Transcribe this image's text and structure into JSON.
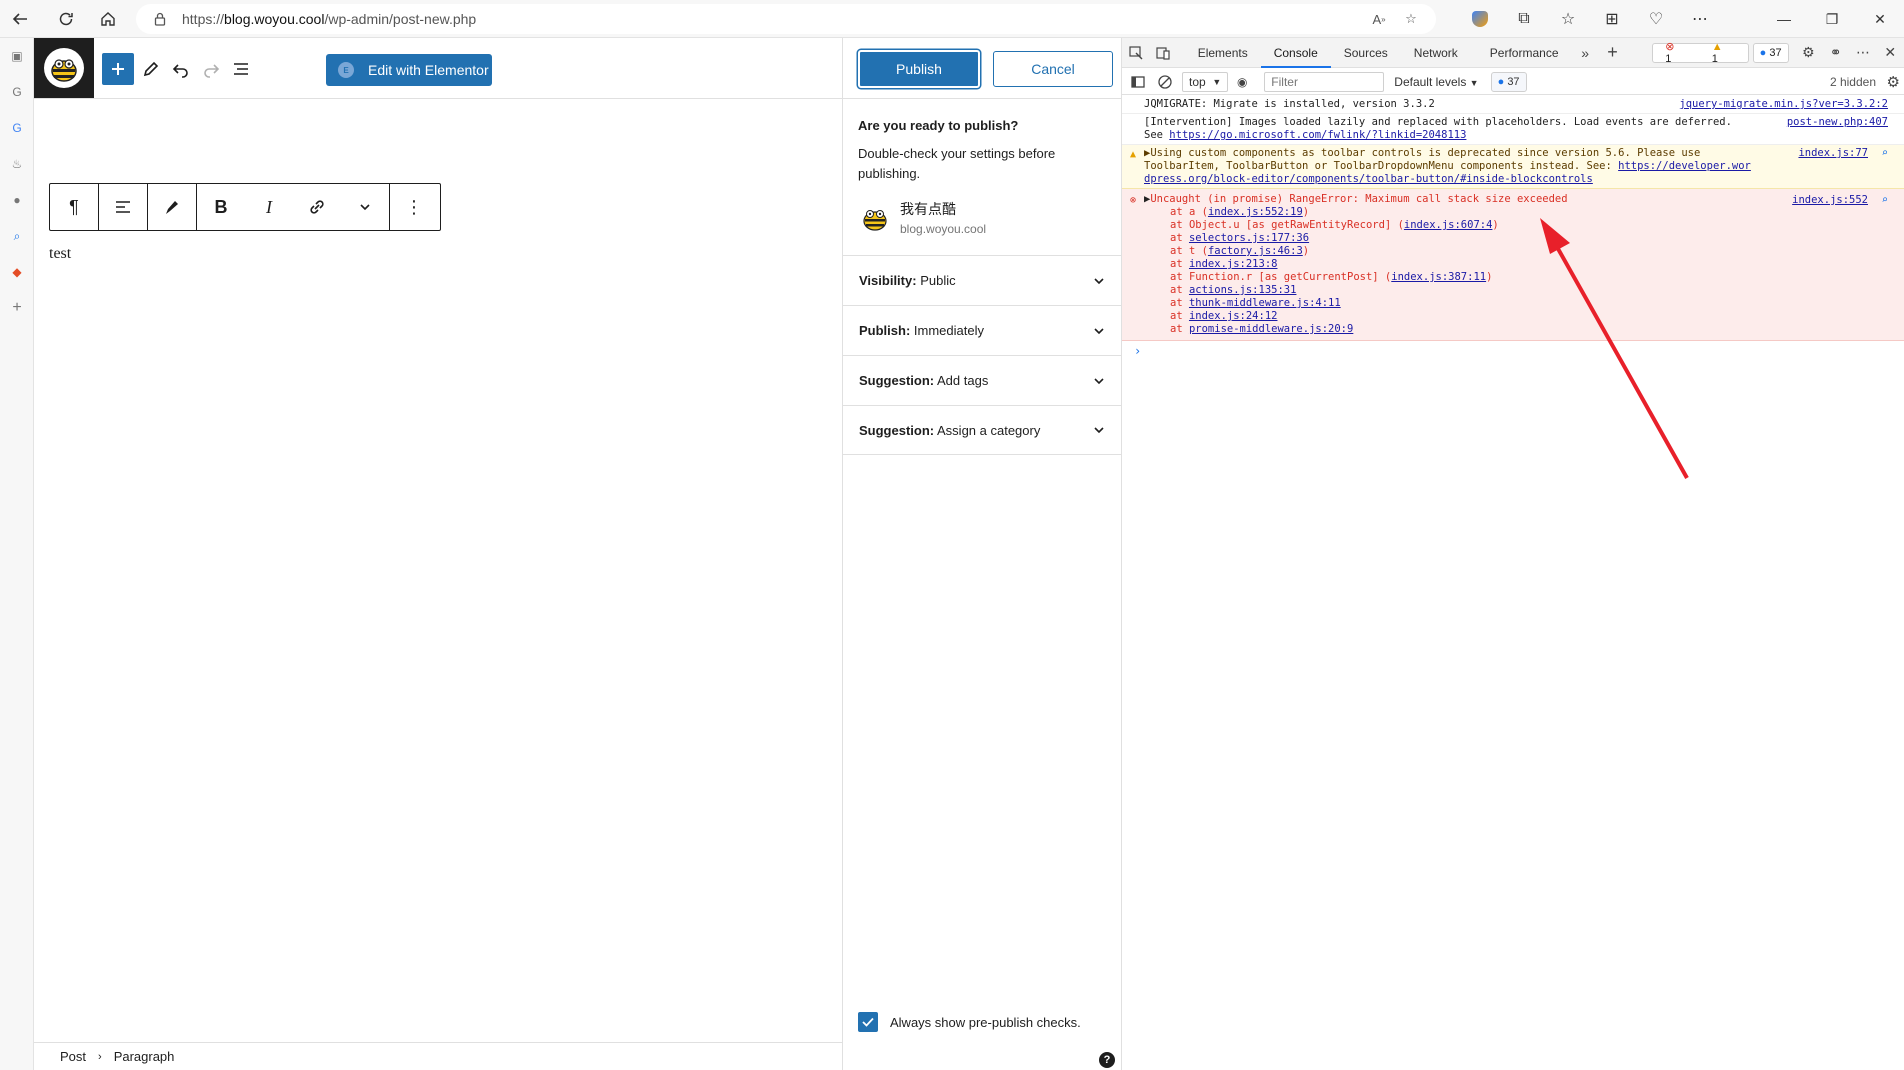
{
  "browser": {
    "url_prefix": "https://",
    "url_domain": "blog.woyou.cool",
    "url_path": "/wp-admin/post-new.php"
  },
  "editor": {
    "elementor_label": "Edit with Elementor",
    "paragraph_text": "test",
    "breadcrumb": [
      "Post",
      "Paragraph"
    ]
  },
  "prepublish": {
    "publish_label": "Publish",
    "cancel_label": "Cancel",
    "heading": "Are you ready to publish?",
    "description": "Double-check your settings before publishing.",
    "site_name": "我有点酷",
    "site_url": "blog.woyou.cool",
    "rows": [
      {
        "key": "Visibility:",
        "value": "Public"
      },
      {
        "key": "Publish:",
        "value": "Immediately"
      },
      {
        "key": "Suggestion:",
        "value": "Add tags"
      },
      {
        "key": "Suggestion:",
        "value": "Assign a category"
      }
    ],
    "always_show_label": "Always show pre-publish checks.",
    "help_glyph": "?"
  },
  "devtools": {
    "tabs": [
      "Elements",
      "Console",
      "Sources",
      "Network",
      "Performance"
    ],
    "active_tab": "Console",
    "error_count": "1",
    "warn_count": "1",
    "info_count": "37",
    "context": "top",
    "filter_placeholder": "Filter",
    "levels": "Default levels",
    "message_count": "37",
    "hidden": "2 hidden",
    "messages": {
      "jqmigrate": "JQMIGRATE: Migrate is installed, version 3.3.2",
      "jqmigrate_src": "jquery-migrate.min.js?ver=3.3.2:2",
      "intervention_1": "[Intervention] Images loaded lazily and replaced with placeholders. Load events are deferred.",
      "intervention_2_prefix": "See ",
      "intervention_link": "https://go.microsoft.com/fwlink/?linkid=2048113",
      "intervention_src": "post-new.php:407",
      "warn_1": "Using custom components as toolbar controls is deprecated since version 5.6. Please use",
      "warn_2_text": "ToolbarItem, ToolbarButton or ToolbarDropdownMenu components instead. See: ",
      "warn_2_link": "https://developer.wor",
      "warn_3_link": "dpress.org/block-editor/components/toolbar-button/#inside-blockcontrols",
      "warn_src": "index.js:77",
      "error_head": "Uncaught (in promise) RangeError: Maximum call stack size exceeded",
      "error_src": "index.js:552",
      "stack": [
        {
          "pre": "at a (",
          "link": "index.js:552:19",
          "post": ")"
        },
        {
          "pre": "at Object.u [as getRawEntityRecord] (",
          "link": "index.js:607:4",
          "post": ")"
        },
        {
          "pre": "at ",
          "link": "selectors.js:177:36",
          "post": ""
        },
        {
          "pre": "at t (",
          "link": "factory.js:46:3",
          "post": ")"
        },
        {
          "pre": "at ",
          "link": "index.js:213:8",
          "post": ""
        },
        {
          "pre": "at Function.r [as getCurrentPost] (",
          "link": "index.js:387:11",
          "post": ")"
        },
        {
          "pre": "at ",
          "link": "actions.js:135:31",
          "post": ""
        },
        {
          "pre": "at ",
          "link": "thunk-middleware.js:4:11",
          "post": ""
        },
        {
          "pre": "at ",
          "link": "index.js:24:12",
          "post": ""
        },
        {
          "pre": "at ",
          "link": "promise-middleware.js:20:9",
          "post": ""
        }
      ]
    }
  },
  "colors": {
    "wp_blue": "#2271b1",
    "error_red": "#d93025",
    "annotation_red": "#e8202a"
  }
}
